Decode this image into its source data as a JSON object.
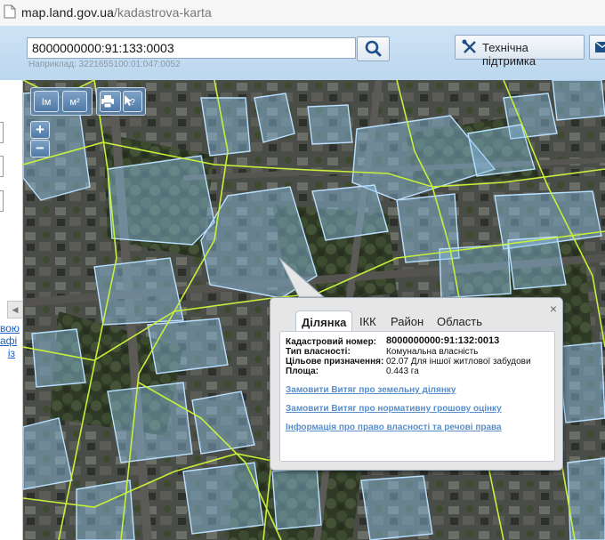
{
  "browser": {
    "url_host": "map.land.gov.ua",
    "url_path": "/kadastrova-karta"
  },
  "header": {
    "search_value": "8000000000:91:133:0003",
    "search_hint": "Наприклад: 3221655100:01:047:0052",
    "support_label": "Технічна підтримка"
  },
  "left_panel": {
    "links": [
      "вою",
      "афі",
      "із"
    ]
  },
  "map_tools": {
    "measure_length": "Iм",
    "measure_area": "м²",
    "print": "print-icon",
    "info": "?"
  },
  "zoom": {
    "in": "+",
    "out": "−"
  },
  "popup": {
    "close": "×",
    "tabs": [
      "Ділянка",
      "ІКК",
      "Район",
      "Область"
    ],
    "fields": [
      {
        "key": "Кадастровий номер:",
        "value": "8000000000:91:132:0013"
      },
      {
        "key": "Тип власності:",
        "value": "Комунальна власність"
      },
      {
        "key": "Цільове призначення:",
        "value": "02.07 Для іншої житлової забудови"
      },
      {
        "key": "Площа:",
        "value": "0.443 га"
      }
    ],
    "links": [
      "Замовити Витяг про земельну ділянку",
      "Замовити Витяг про нормативну грошову оцінку",
      "Інформація про право власності та речові права"
    ]
  },
  "colors": {
    "parcel_fill": "#8fc3e8",
    "boundary": "#c6f03b",
    "popup_link": "#5a8ec9"
  }
}
